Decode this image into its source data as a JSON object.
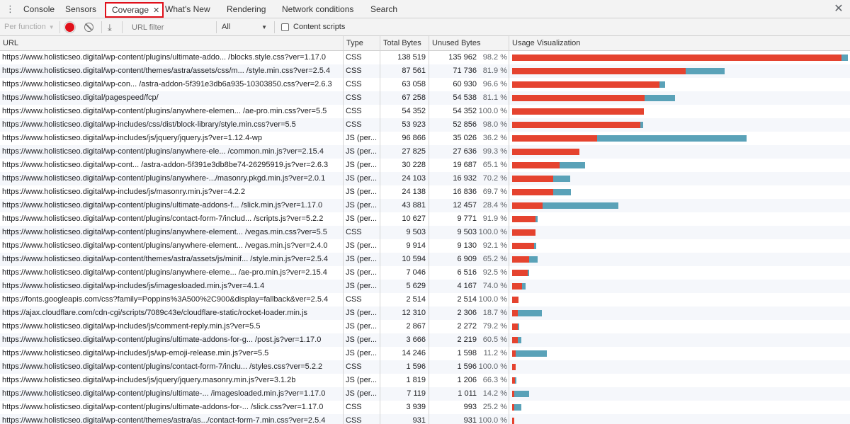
{
  "tabs": [
    "Console",
    "Sensors",
    "Coverage",
    "What's New",
    "Rendering",
    "Network conditions",
    "Search"
  ],
  "active_tab": "Coverage",
  "toolbar": {
    "per_function_label": "Per function",
    "url_filter_placeholder": "URL filter",
    "type_filter_value": "All",
    "content_scripts_label": "Content scripts",
    "content_scripts_checked": false
  },
  "table": {
    "columns": [
      "URL",
      "Type",
      "Total Bytes",
      "Unused Bytes",
      "Usage Visualization"
    ],
    "rows": [
      {
        "url": "https://www.holisticseo.digital/wp-content/plugins/ultimate-addo... /blocks.style.css?ver=1.17.0",
        "type": "CSS",
        "total": "138 519",
        "unused": "135 962",
        "unused_pct": "98.2 %",
        "total_n": 138519,
        "unused_n": 135962
      },
      {
        "url": "https://www.holisticseo.digital/wp-content/themes/astra/assets/css/m... /style.min.css?ver=2.5.4",
        "type": "CSS",
        "total": "87 561",
        "unused": "71 736",
        "unused_pct": "81.9 %",
        "total_n": 87561,
        "unused_n": 71736
      },
      {
        "url": "https://www.holisticseo.digital/wp-con... /astra-addon-5f391e3db6a935-10303850.css?ver=2.6.3",
        "type": "CSS",
        "total": "63 058",
        "unused": "60 930",
        "unused_pct": "96.6 %",
        "total_n": 63058,
        "unused_n": 60930
      },
      {
        "url": "https://www.holisticseo.digital/pagespeed/fcp/",
        "type": "CSS",
        "total": "67 258",
        "unused": "54 538",
        "unused_pct": "81.1 %",
        "total_n": 67258,
        "unused_n": 54538
      },
      {
        "url": "https://www.holisticseo.digital/wp-content/plugins/anywhere-elemen... /ae-pro.min.css?ver=5.5",
        "type": "CSS",
        "total": "54 352",
        "unused": "54 352",
        "unused_pct": "100.0 %",
        "total_n": 54352,
        "unused_n": 54352
      },
      {
        "url": "https://www.holisticseo.digital/wp-includes/css/dist/block-library/style.min.css?ver=5.5",
        "type": "CSS",
        "total": "53 923",
        "unused": "52 856",
        "unused_pct": "98.0 %",
        "total_n": 53923,
        "unused_n": 52856
      },
      {
        "url": "https://www.holisticseo.digital/wp-includes/js/jquery/jquery.js?ver=1.12.4-wp",
        "type": "JS (per...",
        "total": "96 866",
        "unused": "35 026",
        "unused_pct": "36.2 %",
        "total_n": 96866,
        "unused_n": 35026
      },
      {
        "url": "https://www.holisticseo.digital/wp-content/plugins/anywhere-ele... /common.min.js?ver=2.15.4",
        "type": "JS (per...",
        "total": "27 825",
        "unused": "27 636",
        "unused_pct": "99.3 %",
        "total_n": 27825,
        "unused_n": 27636
      },
      {
        "url": "https://www.holisticseo.digital/wp-cont... /astra-addon-5f391e3db8be74-26295919.js?ver=2.6.3",
        "type": "JS (per...",
        "total": "30 228",
        "unused": "19 687",
        "unused_pct": "65.1 %",
        "total_n": 30228,
        "unused_n": 19687
      },
      {
        "url": "https://www.holisticseo.digital/wp-content/plugins/anywhere-.../masonry.pkgd.min.js?ver=2.0.1",
        "type": "JS (per...",
        "total": "24 103",
        "unused": "16 932",
        "unused_pct": "70.2 %",
        "total_n": 24103,
        "unused_n": 16932
      },
      {
        "url": "https://www.holisticseo.digital/wp-includes/js/masonry.min.js?ver=4.2.2",
        "type": "JS (per...",
        "total": "24 138",
        "unused": "16 836",
        "unused_pct": "69.7 %",
        "total_n": 24138,
        "unused_n": 16836
      },
      {
        "url": "https://www.holisticseo.digital/wp-content/plugins/ultimate-addons-f... /slick.min.js?ver=1.17.0",
        "type": "JS (per...",
        "total": "43 881",
        "unused": "12 457",
        "unused_pct": "28.4 %",
        "total_n": 43881,
        "unused_n": 12457
      },
      {
        "url": "https://www.holisticseo.digital/wp-content/plugins/contact-form-7/includ... /scripts.js?ver=5.2.2",
        "type": "JS (per...",
        "total": "10 627",
        "unused": "9 771",
        "unused_pct": "91.9 %",
        "total_n": 10627,
        "unused_n": 9771
      },
      {
        "url": "https://www.holisticseo.digital/wp-content/plugins/anywhere-element... /vegas.min.css?ver=5.5",
        "type": "CSS",
        "total": "9 503",
        "unused": "9 503",
        "unused_pct": "100.0 %",
        "total_n": 9503,
        "unused_n": 9503
      },
      {
        "url": "https://www.holisticseo.digital/wp-content/plugins/anywhere-element... /vegas.min.js?ver=2.4.0",
        "type": "JS (per...",
        "total": "9 914",
        "unused": "9 130",
        "unused_pct": "92.1 %",
        "total_n": 9914,
        "unused_n": 9130
      },
      {
        "url": "https://www.holisticseo.digital/wp-content/themes/astra/assets/js/minif... /style.min.js?ver=2.5.4",
        "type": "JS (per...",
        "total": "10 594",
        "unused": "6 909",
        "unused_pct": "65.2 %",
        "total_n": 10594,
        "unused_n": 6909
      },
      {
        "url": "https://www.holisticseo.digital/wp-content/plugins/anywhere-eleme... /ae-pro.min.js?ver=2.15.4",
        "type": "JS (per...",
        "total": "7 046",
        "unused": "6 516",
        "unused_pct": "92.5 %",
        "total_n": 7046,
        "unused_n": 6516
      },
      {
        "url": "https://www.holisticseo.digital/wp-includes/js/imagesloaded.min.js?ver=4.1.4",
        "type": "JS (per...",
        "total": "5 629",
        "unused": "4 167",
        "unused_pct": "74.0 %",
        "total_n": 5629,
        "unused_n": 4167
      },
      {
        "url": "https://fonts.googleapis.com/css?family=Poppins%3A500%2C900&display=fallback&ver=2.5.4",
        "type": "CSS",
        "total": "2 514",
        "unused": "2 514",
        "unused_pct": "100.0 %",
        "total_n": 2514,
        "unused_n": 2514
      },
      {
        "url": "https://ajax.cloudflare.com/cdn-cgi/scripts/7089c43e/cloudflare-static/rocket-loader.min.js",
        "type": "JS (per...",
        "total": "12 310",
        "unused": "2 306",
        "unused_pct": "18.7 %",
        "total_n": 12310,
        "unused_n": 2306
      },
      {
        "url": "https://www.holisticseo.digital/wp-includes/js/comment-reply.min.js?ver=5.5",
        "type": "JS (per...",
        "total": "2 867",
        "unused": "2 272",
        "unused_pct": "79.2 %",
        "total_n": 2867,
        "unused_n": 2272
      },
      {
        "url": "https://www.holisticseo.digital/wp-content/plugins/ultimate-addons-for-g... /post.js?ver=1.17.0",
        "type": "JS (per...",
        "total": "3 666",
        "unused": "2 219",
        "unused_pct": "60.5 %",
        "total_n": 3666,
        "unused_n": 2219
      },
      {
        "url": "https://www.holisticseo.digital/wp-includes/js/wp-emoji-release.min.js?ver=5.5",
        "type": "JS (per...",
        "total": "14 246",
        "unused": "1 598",
        "unused_pct": "11.2 %",
        "total_n": 14246,
        "unused_n": 1598
      },
      {
        "url": "https://www.holisticseo.digital/wp-content/plugins/contact-form-7/inclu... /styles.css?ver=5.2.2",
        "type": "CSS",
        "total": "1 596",
        "unused": "1 596",
        "unused_pct": "100.0 %",
        "total_n": 1596,
        "unused_n": 1596
      },
      {
        "url": "https://www.holisticseo.digital/wp-includes/js/jquery/jquery.masonry.min.js?ver=3.1.2b",
        "type": "JS (per...",
        "total": "1 819",
        "unused": "1 206",
        "unused_pct": "66.3 %",
        "total_n": 1819,
        "unused_n": 1206
      },
      {
        "url": "https://www.holisticseo.digital/wp-content/plugins/ultimate-... /imagesloaded.min.js?ver=1.17.0",
        "type": "JS (per...",
        "total": "7 119",
        "unused": "1 011",
        "unused_pct": "14.2 %",
        "total_n": 7119,
        "unused_n": 1011
      },
      {
        "url": "https://www.holisticseo.digital/wp-content/plugins/ultimate-addons-for-... /slick.css?ver=1.17.0",
        "type": "CSS",
        "total": "3 939",
        "unused": "993",
        "unused_pct": "25.2 %",
        "total_n": 3939,
        "unused_n": 993
      },
      {
        "url": "https://www.holisticseo.digital/wp-content/themes/astra/as.../contact-form-7.min.css?ver=2.5.4",
        "type": "CSS",
        "total": "931",
        "unused": "931",
        "unused_pct": "100.0 %",
        "total_n": 931,
        "unused_n": 931
      }
    ]
  },
  "colors": {
    "unused": "#e5432f",
    "used": "#5aa2b8",
    "highlight_border": "#e0101a"
  },
  "icons": [
    "more-vert-icon",
    "record-icon",
    "clear-icon",
    "download-icon",
    "close-icon"
  ]
}
